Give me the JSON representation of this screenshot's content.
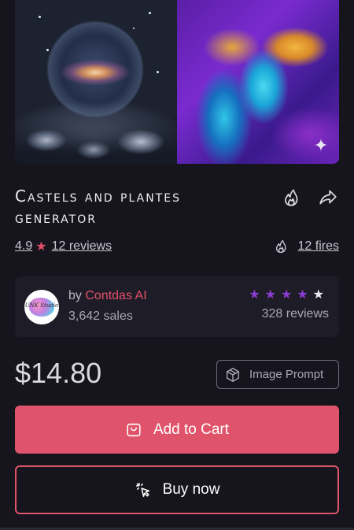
{
  "gallery": {
    "images": [
      {
        "name": "galaxy-sphere-image"
      },
      {
        "name": "fluid-art-image"
      }
    ],
    "sparkle_icon": "sparkle-icon"
  },
  "product": {
    "title": "Castels and plantes generator",
    "rating": "4.9",
    "reviews_link": "12 reviews",
    "fires_link": "12 fires"
  },
  "seller": {
    "by_prefix": "by",
    "name": "Contdas AI",
    "avatar_text": "UNK Studio",
    "sales": "3,642 sales",
    "stars": 4,
    "stars_max": 5,
    "reviews": "328 reviews"
  },
  "pricing": {
    "price": "$14.80",
    "prompt_type": "Image Prompt"
  },
  "actions": {
    "add_to_cart": "Add to Cart",
    "buy_now": "Buy now"
  },
  "colors": {
    "accent": "#e0546b",
    "star_purple": "#8c3bd0",
    "background": "#16151d",
    "card": "#1e1d27"
  }
}
